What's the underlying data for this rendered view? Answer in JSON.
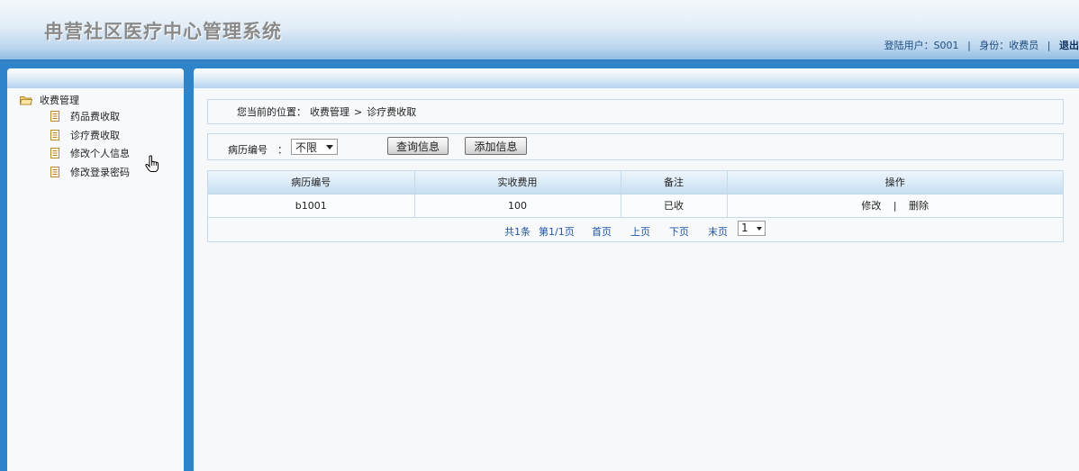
{
  "header": {
    "title": "冉营社区医疗中心管理系统",
    "user_label": "登陆用户：S001",
    "role_label": "身份：收费员",
    "separator": "|",
    "logout": "退出"
  },
  "sidebar": {
    "root_label": "收费管理",
    "items": [
      {
        "label": "药品费收取"
      },
      {
        "label": "诊疗费收取"
      },
      {
        "label": "修改个人信息"
      },
      {
        "label": "修改登录密码"
      }
    ]
  },
  "breadcrumb": {
    "prefix": "您当前的位置：",
    "level1": "收费管理",
    "arrow": ">",
    "level2": "诊疗费收取"
  },
  "search": {
    "label": "病历编号",
    "colon": "：",
    "select_value": "不限",
    "query_button": "查询信息",
    "add_button": "添加信息"
  },
  "table": {
    "columns": [
      "病历编号",
      "实收费用",
      "备注",
      "操作"
    ],
    "rows": [
      {
        "record_no": "b1001",
        "amount": "100",
        "note": "已收",
        "edit": "修改",
        "sep": "|",
        "delete": "删除"
      }
    ]
  },
  "pager": {
    "total": "共1条",
    "page_info": "第1/1页",
    "first": "首页",
    "prev": "上页",
    "next": "下页",
    "last": "末页",
    "page_select": "1"
  },
  "colors": {
    "accent": "#2f83c9",
    "link": "#1f55a5",
    "border": "#c5d9ec"
  }
}
